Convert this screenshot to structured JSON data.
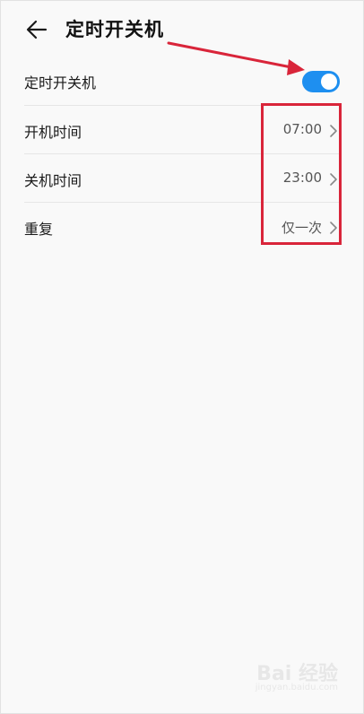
{
  "header": {
    "title": "定时开关机",
    "back_icon": "back-arrow-icon"
  },
  "toggle_row": {
    "label": "定时开关机",
    "enabled": true,
    "accent": "#1e8ff0"
  },
  "rows": [
    {
      "label": "开机时间",
      "value": "07:00"
    },
    {
      "label": "关机时间",
      "value": "23:00"
    },
    {
      "label": "重复",
      "value": "仅一次"
    }
  ],
  "annotation": {
    "arrow_color": "#d9253a",
    "box_color": "#d9253a"
  },
  "watermark": {
    "text": "Bai 经验",
    "sub": "jingyan.baidu.com"
  }
}
